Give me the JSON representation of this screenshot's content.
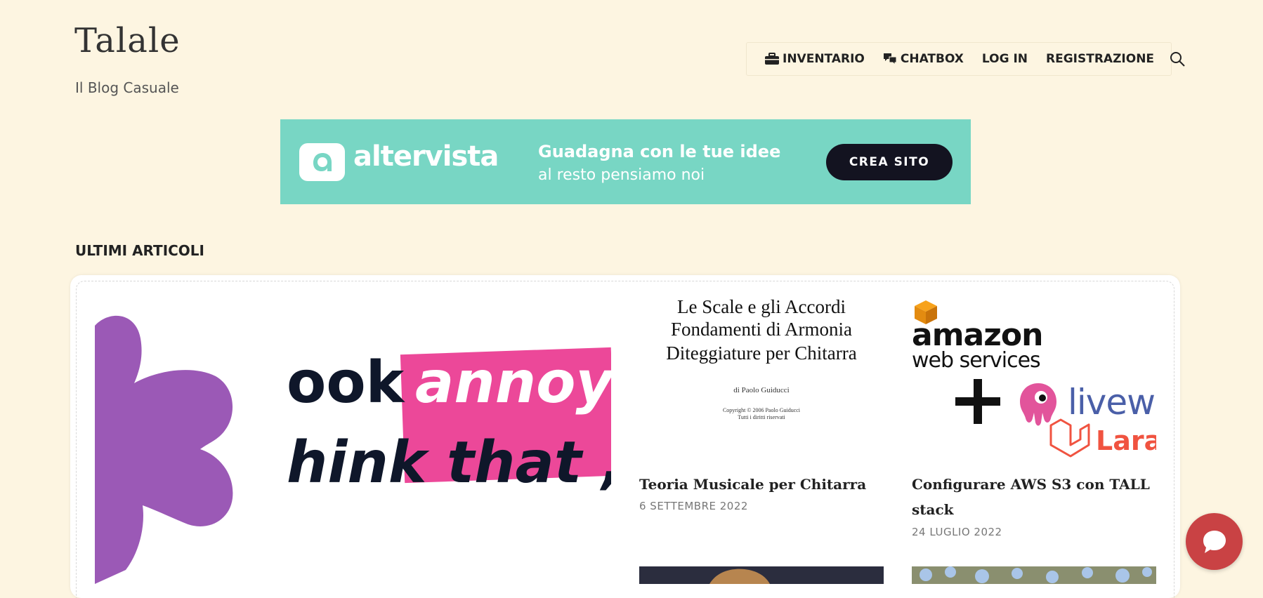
{
  "site": {
    "title": "Talale",
    "tagline": "Il Blog Casuale"
  },
  "nav": {
    "items": [
      {
        "label": "INVENTARIO",
        "icon": "briefcase-icon"
      },
      {
        "label": "CHATBOX",
        "icon": "chat-icon"
      },
      {
        "label": "LOG IN"
      },
      {
        "label": "REGISTRAZIONE"
      }
    ],
    "search_icon": "search-icon"
  },
  "banner": {
    "brand": "altervista",
    "line1": "Guadagna con le tue idee",
    "line2": "al resto pensiamo noi",
    "cta": "CREA SITO",
    "color": "#78d6c4"
  },
  "section": {
    "title": "ULTIMI ARTICOLI"
  },
  "featured": {
    "text_line1": "ook",
    "text_highlight": "annoy",
    "text_line2": "hink that ,"
  },
  "posts": [
    {
      "thumb_lines": [
        "Le Scale e gli Accordi",
        "Fondamenti di Armonia",
        "Diteggiature per Chitarra"
      ],
      "thumb_author": "di Paolo Guiducci",
      "thumb_copyright": "Copyright © 2006 Paolo Guiducci",
      "thumb_rights": "Tutti i diritti riservati",
      "title": "Teoria Musicale per Chitarra",
      "date": "6 SETTEMBRE 2022"
    },
    {
      "thumb_text1": "amazon",
      "thumb_text2": "web services",
      "thumb_text3": "livew",
      "thumb_text4": "Lara",
      "title": "Configurare AWS S3 con TALL stack",
      "date": "24 LUGLIO 2022"
    }
  ],
  "colors": {
    "background": "#fdf5e1",
    "chat": "#c94244",
    "highlight": "#ec4899",
    "purple": "#9b59b6"
  }
}
